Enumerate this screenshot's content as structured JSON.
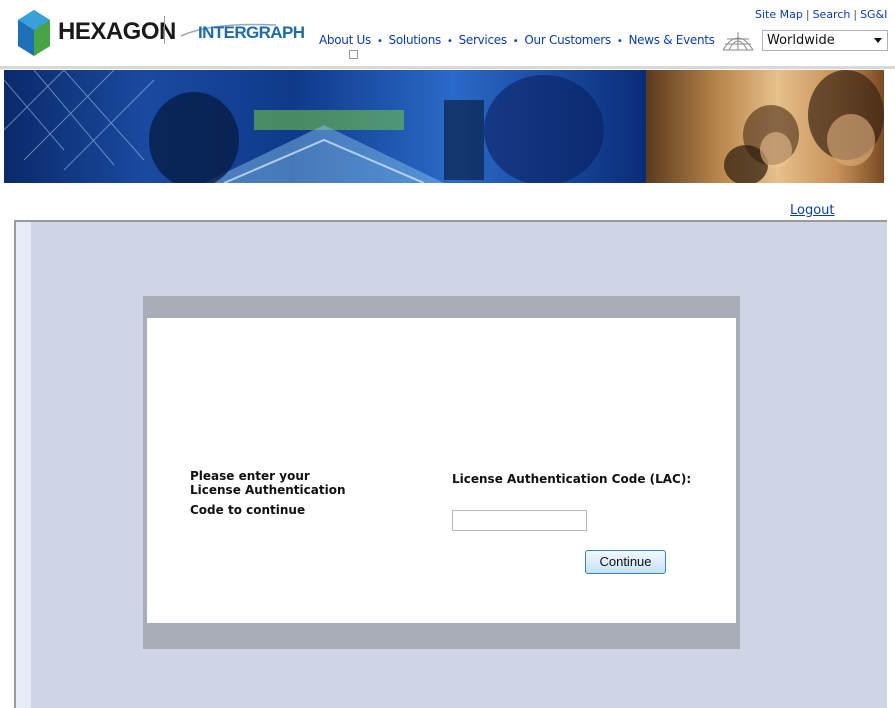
{
  "header": {
    "brand_primary": "HEXAGON",
    "brand_secondary": "INTERGRAPH",
    "utility_links": [
      "Site Map",
      "Search",
      "SG&I"
    ],
    "nav": [
      "About Us",
      "Solutions",
      "Services",
      "Our Customers",
      "News & Events"
    ],
    "region": {
      "selected": "Worldwide"
    }
  },
  "account": {
    "logout_label": "Logout"
  },
  "form": {
    "prompt_line1": "Please enter your",
    "prompt_line2": "License Authentication",
    "prompt_line3": "Code to continue",
    "lac_label": "License Authentication Code (LAC):",
    "lac_value": "",
    "continue_label": "Continue"
  },
  "colors": {
    "link": "#0b3ea8",
    "content_background": "#cdd5e7",
    "panel_border": "#a9adb7",
    "intergraph_blue": "#1f6aa8"
  },
  "icons": {
    "hexagon_logo": "hexagon-logo-icon",
    "globe": "globe-icon",
    "dropdown": "chevron-down-icon"
  }
}
